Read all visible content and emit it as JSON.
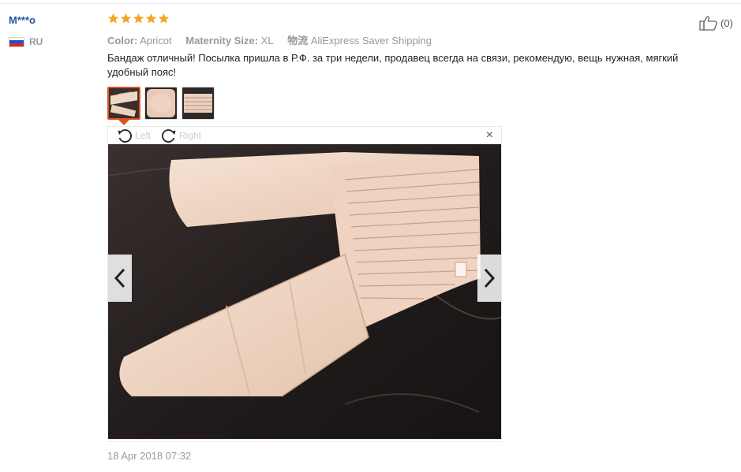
{
  "review": {
    "user_name": "M***o",
    "country_code": "RU",
    "flag_colors": [
      "#ffffff",
      "#1f4fd0",
      "#d52b1e"
    ],
    "rating": 5,
    "star_color": "#f5a623",
    "helpful_count": "(0)",
    "attributes": [
      {
        "label": "Color:",
        "value": "Apricot"
      },
      {
        "label": "Maternity Size:",
        "value": "XL"
      },
      {
        "label": "物流",
        "value": "AliExpress Saver Shipping"
      }
    ],
    "text": "Бандаж отличный! Посылка пришла в Р.Ф. за три недели, продавец всегда на связи, рекомендую, вещь нужная, мягкий удобный пояс!",
    "date": "18 Apr 2018 07:32"
  },
  "viewer": {
    "rotate_left_label": "Left",
    "rotate_right_label": "Right",
    "close_label": "×",
    "active_thumb": 0,
    "thumb_count": 3
  },
  "colors": {
    "accent": "#e05420",
    "username": "#1f52a8",
    "belt": "#f1d9c6"
  }
}
